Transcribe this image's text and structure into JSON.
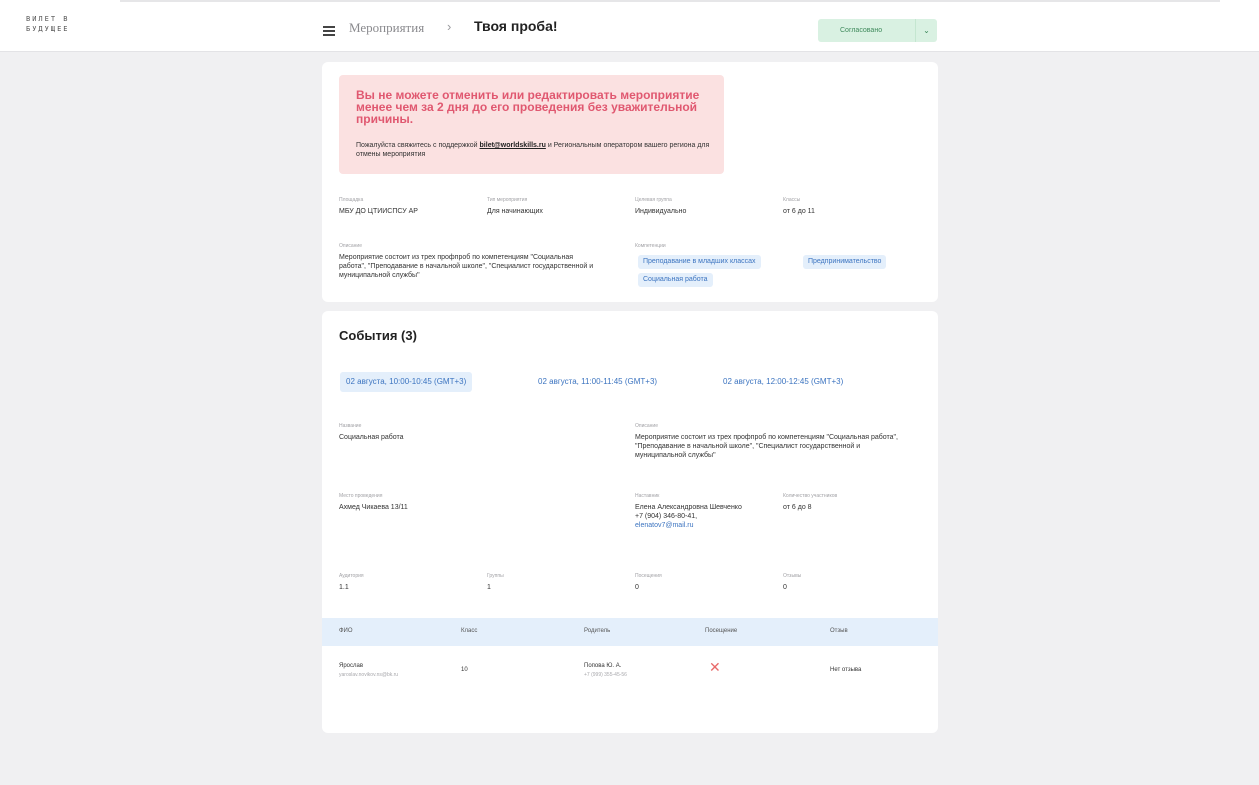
{
  "logo": {
    "line1": "ВИЛЕТ В",
    "line2": "БУДУЩЕЕ"
  },
  "header": {
    "breadcrumb_parent": "Мероприятия",
    "separator": "›",
    "breadcrumb_current": "Твоя проба!",
    "status_label": "Согласовано",
    "status_chevron": "⌄"
  },
  "alert": {
    "title": "Вы не можете отменить или редактировать мероприятие менее чем за 2 дня до его проведения без уважительной причины.",
    "text_before": "Пожалуйста свяжитесь с поддержкой",
    "email": "bilet@worldskills.ru",
    "text_after": "и Региональным оператором вашего региона для отмены мероприятия"
  },
  "info": {
    "platform_label": "Площадка",
    "platform_value": "МБУ ДО ЦТИИСПСУ АР",
    "type_label": "Тип мероприятия",
    "type_value": "Для начинающих",
    "age_label": "Целевая группа",
    "age_value": "Индивидуально",
    "class_label": "Классы",
    "class_value": "от 6 до 11",
    "desc_label": "Описание",
    "desc_value": "Мероприятие состоит из трех профпроб по компетенциям \"Социальная работа\", \"Преподавание в начальной школе\", \"Специалист государственной и муниципальной службы\"",
    "comp_label": "Компетенции",
    "competencies": [
      "Преподавание в младших классах",
      "Предпринимательство",
      "Социальная работа"
    ]
  },
  "events": {
    "title": "События (3)",
    "tabs": [
      "02 августа, 10:00-10:45 (GMT+3)",
      "02 августа, 11:00-11:45 (GMT+3)",
      "02 августа, 12:00-12:45 (GMT+3)"
    ],
    "name_label": "Название",
    "name_value": "Социальная работа",
    "desc_label": "Описание",
    "desc_value": "Мероприятие состоит из трех профпроб по компетенциям \"Социальная работа\", \"Преподавание в начальной школе\", \"Специалист государственной и муниципальной службы\"",
    "place_label": "Место проведения",
    "place_value": "Ахмед Чикаева 13/11",
    "contact_label": "Наставник",
    "contact_name": "Елена Александровна Шевченко",
    "contact_phone": "+7 (904) 346-80-41,",
    "contact_email": "elenatov7@mail.ru",
    "participants_label": "Количество участников",
    "participants_value": "от 6 до 8",
    "audience_label": "Аудитория",
    "audience_value": "1.1",
    "groups_label": "Группы",
    "groups_value": "1",
    "attended_label": "Посещения",
    "attended_value": "0",
    "reviews_label": "Отзывы",
    "reviews_value": "0"
  },
  "table": {
    "headers": [
      "ФИО",
      "Класс",
      "Родитель",
      "Посещение",
      "Отзыв"
    ],
    "rows": [
      {
        "name": "Ярослав",
        "email": "yaroslav.novikov.ns@bk.ru",
        "class": "10",
        "parent": "Попова Ю. А.",
        "parent_phone": "+7 (999) 355-45-56",
        "attendance": "✕",
        "review": "Нет отзыва"
      }
    ]
  }
}
